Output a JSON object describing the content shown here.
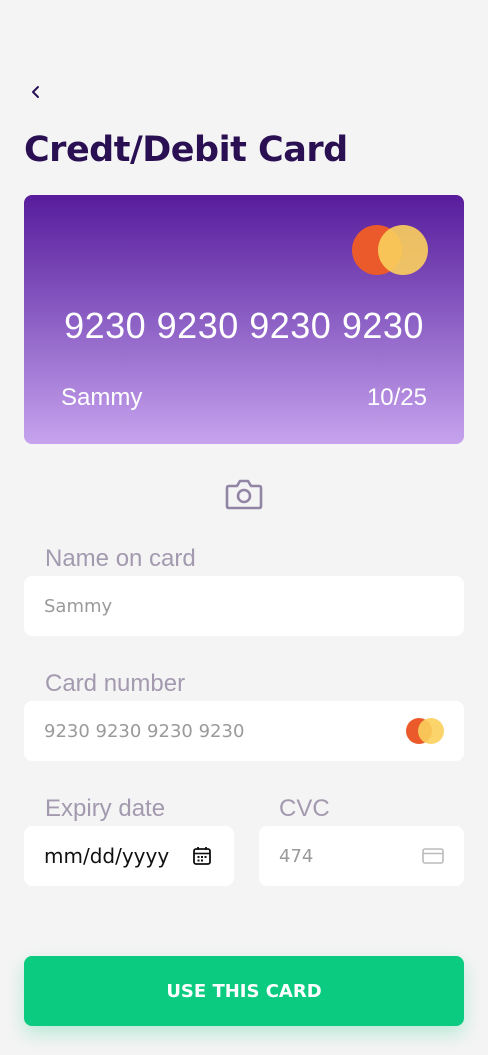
{
  "header": {
    "title": "Credt/Debit Card",
    "back_icon": "chevron-left-icon"
  },
  "card_preview": {
    "number": "9230 9230 9230 9230",
    "holder": "Sammy",
    "expiry": "10/25",
    "brand": "mastercard-logo",
    "gradient_colors": [
      "#581c9c",
      "#8b5fc4",
      "#c7a3ee"
    ]
  },
  "camera": {
    "icon": "camera-icon"
  },
  "form": {
    "name_label": "Name on card",
    "name_placeholder": "Sammy",
    "number_label": "Card number",
    "number_placeholder": "9230 9230 9230 9230",
    "expiry_label": "Expiry date",
    "expiry_value": "mm/dd/yyyy",
    "cvc_label": "CVC",
    "cvc_placeholder": "474"
  },
  "actions": {
    "submit_label": "USE THIS CARD"
  },
  "colors": {
    "background": "#f4f4f4",
    "title": "#2a1052",
    "label": "#a39ab0",
    "accent_green": "#0acb80",
    "brand_red": "#ea5a2a",
    "brand_yellow": "#fbcf5c"
  }
}
